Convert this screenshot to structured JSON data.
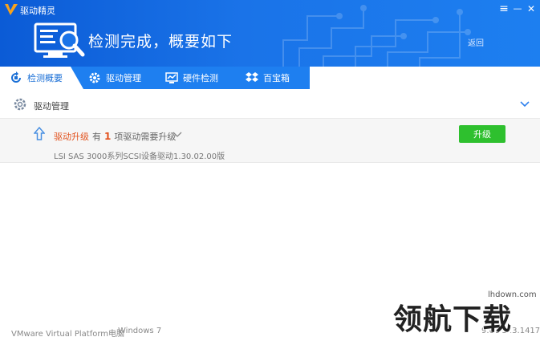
{
  "window": {
    "app_title": "驱动精灵",
    "menu_glyph": "≡",
    "minimize_glyph": "—",
    "close_glyph": "✕"
  },
  "hero": {
    "title": "检测完成，概要如下",
    "back_label": "返回"
  },
  "tabs": [
    {
      "label": "检测概要",
      "icon": "refresh-check-icon",
      "active": true
    },
    {
      "label": "驱动管理",
      "icon": "gear-icon",
      "active": false
    },
    {
      "label": "硬件检测",
      "icon": "monitor-chart-icon",
      "active": false
    },
    {
      "label": "百宝箱",
      "icon": "dropbox-icon",
      "active": false
    }
  ],
  "section": {
    "title": "驱动管理"
  },
  "upgrade_row": {
    "label": "驱动升级",
    "prefix": "有",
    "count": "1",
    "suffix": "项驱动需要升级",
    "button_label": "升级",
    "driver_name": "LSI SAS 3000系列SCSI设备驱动1.30.02.00版"
  },
  "footer": {
    "system": "VMware Virtual Platform电脑",
    "os": "Windows 7",
    "version": "9.61.323.1417"
  },
  "watermark": {
    "url": "lhdown.com",
    "text": "领航下载"
  },
  "colors": {
    "header_blue": "#1a73e8",
    "accent_orange": "#e2531f",
    "button_green": "#2ec02e"
  }
}
